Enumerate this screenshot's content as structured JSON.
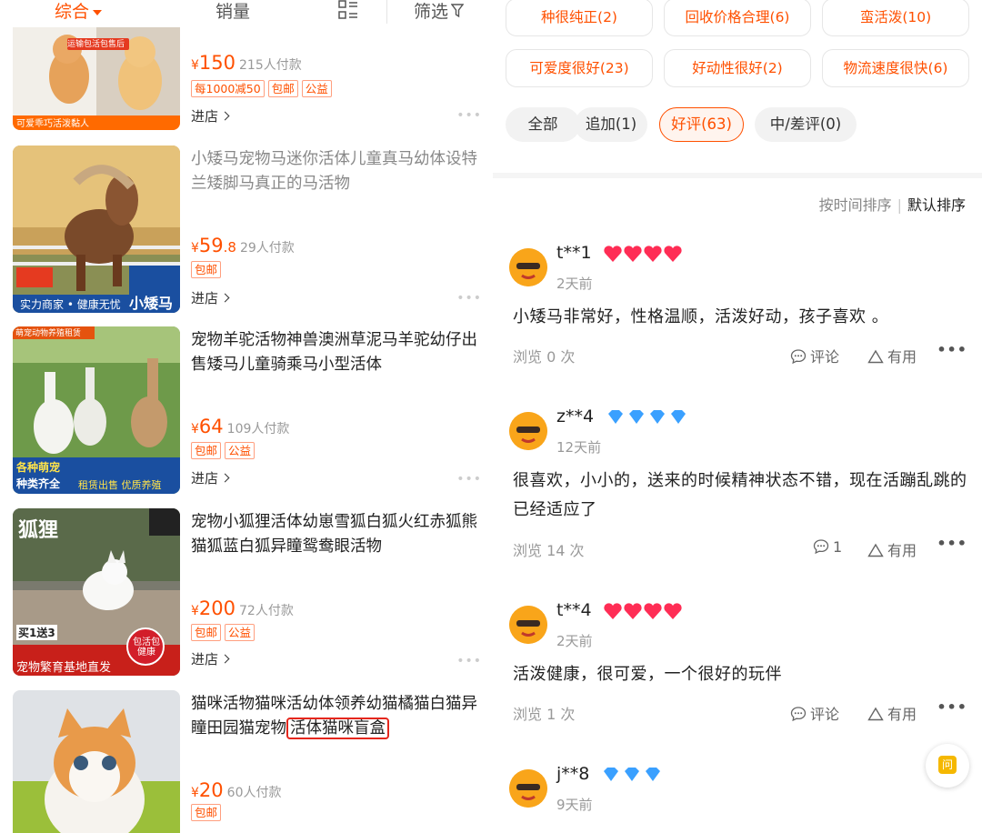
{
  "left": {
    "sort": {
      "comprehensive": "综合",
      "sales": "销量",
      "filter": "筛选"
    },
    "products": [
      {
        "title": "",
        "price_int": "150",
        "price_dec": "",
        "paid": "215人付款",
        "tags": [
          "每1000减50",
          "包邮",
          "公益"
        ],
        "store": "进店",
        "img_caption": "可爱乖巧活泼黏人",
        "img_top": "运输包活包售后"
      },
      {
        "title": "小矮马宠物马迷你活体儿童真马幼体设特兰矮脚马真正的马活物",
        "price_int": "59",
        "price_dec": ".8",
        "paid": "29人付款",
        "tags": [
          "包邮"
        ],
        "store": "进店",
        "img_caption": "实力商家 • 健康无忧",
        "img_brand": "小矮马"
      },
      {
        "title": "宠物羊驼活物神兽澳洲草泥马羊驼幼仔出售矮马儿童骑乘马小型活体",
        "price_int": "64",
        "price_dec": "",
        "paid": "109人付款",
        "tags": [
          "包邮",
          "公益"
        ],
        "store": "进店",
        "img_top": "萌宠动物养殖租赁",
        "img_caption_a": "各种萌宠",
        "img_caption_b": "种类齐全",
        "img_caption_c": "租赁出售 优质养殖"
      },
      {
        "title": "宠物小狐狸活体幼崽雪狐白狐火红赤狐熊猫狐蓝白狐异瞳鸳鸯眼活物",
        "price_int": "200",
        "price_dec": "",
        "paid": "72人付款",
        "tags": [
          "包邮",
          "公益"
        ],
        "store": "进店",
        "img_top": "狐狸",
        "img_caption": "宠物繁育基地直发",
        "img_badge": "包活包健康",
        "img_promo": "买1送3"
      },
      {
        "title_a": "猫咪活物猫咪活幼体领养幼猫橘猫白猫异瞳田园猫宠物",
        "title_hl": "活体猫咪盲盒",
        "price_int": "20",
        "price_dec": "",
        "paid": "60人付款",
        "tags": [
          "包邮"
        ]
      }
    ]
  },
  "right": {
    "chips": [
      "种很纯正(2)",
      "回收价格合理(6)",
      "蛮活泼(10)",
      "可爱度很好(23)",
      "好动性很好(2)",
      "物流速度很快(6)"
    ],
    "tabs": [
      "全部",
      "追加(1)",
      "好评(63)",
      "中/差评(0)"
    ],
    "sort": {
      "by_time": "按时间排序",
      "default": "默认排序"
    },
    "reviews": [
      {
        "name": "t**1",
        "badge": "hearts",
        "time": "2天前",
        "text": "小矮马非常好，性格温顺，活泼好动，孩子喜欢 。",
        "views": "浏览 0 次",
        "comment": "评论",
        "useful": "有用"
      },
      {
        "name": "z**4",
        "badge": "diamonds",
        "time": "12天前",
        "text": "很喜欢，小小的，送来的时候精神状态不错，现在活蹦乱跳的已经适应了",
        "views": "浏览 14 次",
        "comment": "1",
        "useful": "有用"
      },
      {
        "name": "t**4",
        "badge": "hearts",
        "time": "2天前",
        "text": "活泼健康，很可爱，一个很好的玩伴",
        "views": "浏览 1 次",
        "comment": "评论",
        "useful": "有用"
      },
      {
        "name": "j**8",
        "badge": "diamonds",
        "time": "9天前",
        "text": "",
        "views": "",
        "comment": "",
        "useful": ""
      }
    ],
    "float_label": "问",
    "colors": {
      "accent": "#ff5000",
      "heart": "#ff2d55",
      "diamond": "#3aa0ff"
    }
  }
}
